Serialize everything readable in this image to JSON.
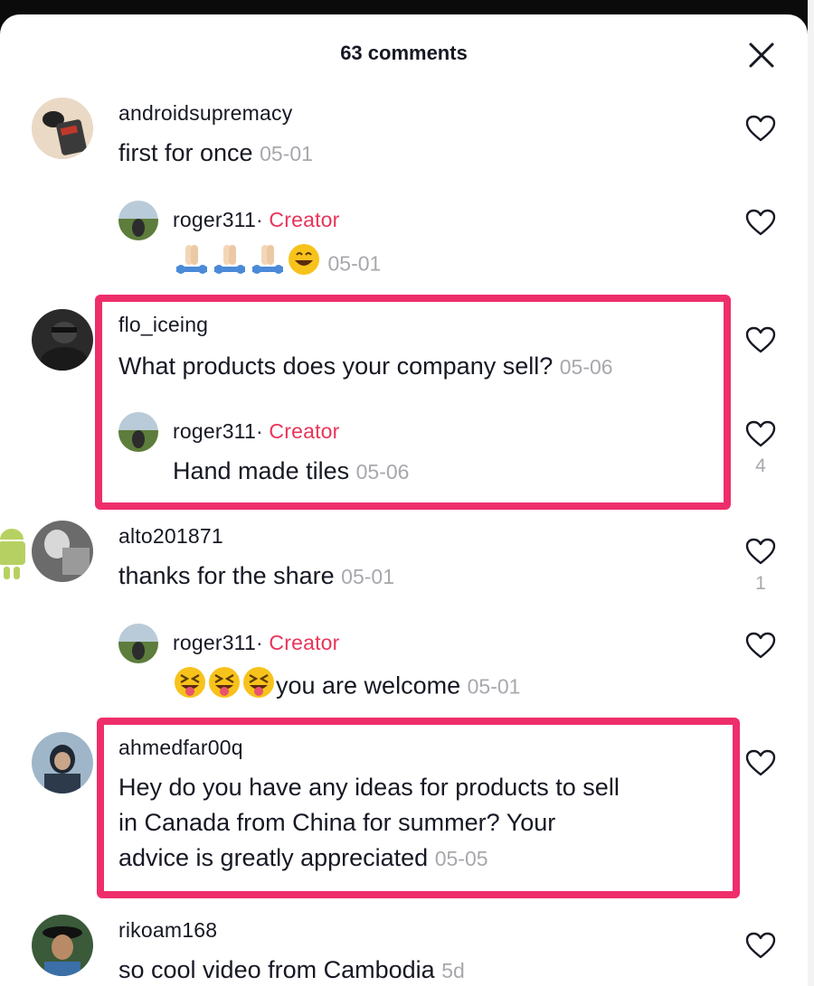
{
  "header": {
    "title": "63 comments"
  },
  "comments": [
    {
      "user": "androidsupremacy",
      "text": "first for once",
      "date": "05-01"
    },
    {
      "user": "roger311",
      "sep": "·",
      "badge": "Creator",
      "text": "",
      "date": "05-01",
      "emoji": [
        "folded-hands-icon",
        "folded-hands-icon",
        "folded-hands-icon",
        "grinning-face-icon"
      ]
    },
    {
      "user": "flo_iceing",
      "text": "What products does your company sell?",
      "date": "05-06"
    },
    {
      "user": "roger311",
      "sep": "·",
      "badge": "Creator",
      "text": "Hand made tiles",
      "date": "05-06",
      "likes": "4"
    },
    {
      "user": "alto201871",
      "text": "thanks for the share",
      "date": "05-01",
      "likes": "1"
    },
    {
      "user": "roger311",
      "sep": "·",
      "badge": "Creator",
      "text": "you are welcome",
      "date": "05-01",
      "emoji": [
        "squinting-tongue-face-icon",
        "squinting-tongue-face-icon",
        "squinting-tongue-face-icon"
      ]
    },
    {
      "user": "ahmedfar00q",
      "text_lines": [
        "Hey do you have any ideas for products to sell",
        "in Canada from China for summer? Your",
        "advice is greatly appreciated"
      ],
      "date": "05-05"
    },
    {
      "user": "rikoam168",
      "text": "so cool video from Cambodia",
      "date": "5d"
    }
  ],
  "colors": {
    "accent": "#ee2e6b",
    "creator": "#e8355a",
    "muted": "#a7a8ad",
    "text": "#161823"
  }
}
